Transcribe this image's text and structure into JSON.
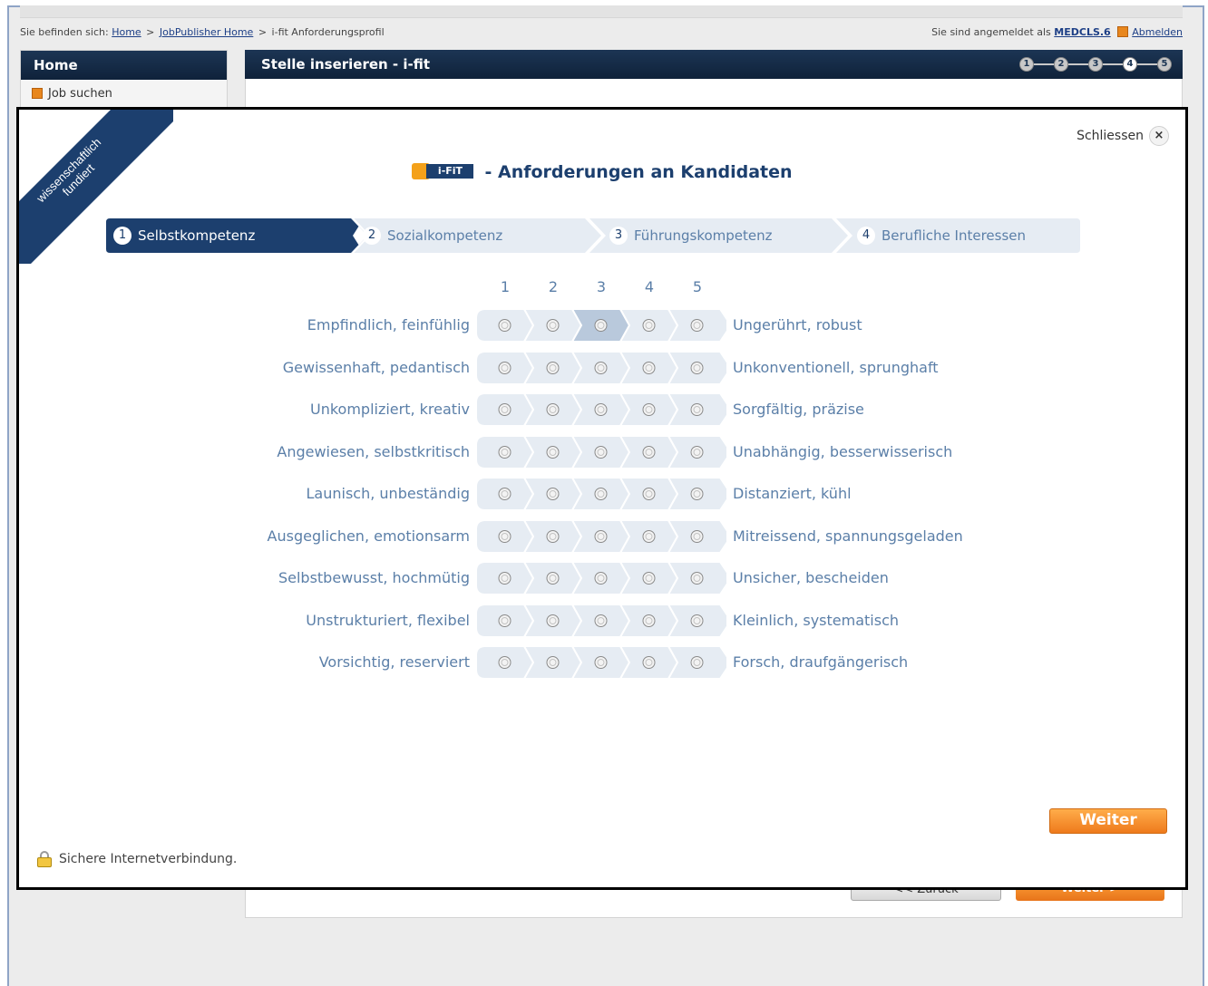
{
  "breadcrumb": {
    "prefix": "Sie befinden sich:",
    "items": [
      "Home",
      "JobPublisher Home",
      "i-fit Anforderungsprofil"
    ],
    "separator": ">"
  },
  "session": {
    "prefix": "Sie sind angemeldet als",
    "user": "MEDCLS.6",
    "logout": "Abmelden"
  },
  "sidebar": {
    "title": "Home",
    "items": [
      {
        "label": "Job suchen"
      }
    ]
  },
  "main": {
    "title": "Stelle inserieren - i-fit",
    "progress_steps": [
      "1",
      "2",
      "3",
      "4",
      "5"
    ],
    "progress_active": 4,
    "back_label": "<< Zurück",
    "next_label": "Weiter >"
  },
  "modal": {
    "ribbon": [
      "wissenschaftlich",
      "fundiert"
    ],
    "close_label": "Schliessen",
    "close_glyph": "×",
    "logo_text": "i-FiT",
    "title": "- Anforderungen an Kandidaten",
    "steps": [
      {
        "num": "1",
        "label": "Selbstkompetenz",
        "active": true
      },
      {
        "num": "2",
        "label": "Sozialkompetenz",
        "active": false
      },
      {
        "num": "3",
        "label": "Führungskompetenz",
        "active": false
      },
      {
        "num": "4",
        "label": "Berufliche Interessen",
        "active": false
      }
    ],
    "scale_labels": [
      "1",
      "2",
      "3",
      "4",
      "5"
    ],
    "rows": [
      {
        "left": "Empfindlich, feinfühlig",
        "right": "Ungerührt, robust",
        "selected": 3
      },
      {
        "left": "Gewissenhaft, pedantisch",
        "right": "Unkonventionell, sprunghaft",
        "selected": null
      },
      {
        "left": "Unkompliziert, kreativ",
        "right": "Sorgfältig, präzise",
        "selected": null
      },
      {
        "left": "Angewiesen, selbstkritisch",
        "right": "Unabhängig, besserwisserisch",
        "selected": null
      },
      {
        "left": "Launisch, unbeständig",
        "right": "Distanziert, kühl",
        "selected": null
      },
      {
        "left": "Ausgeglichen, emotionsarm",
        "right": "Mitreissend, spannungsgeladen",
        "selected": null
      },
      {
        "left": "Selbstbewusst, hochmütig",
        "right": "Unsicher, bescheiden",
        "selected": null
      },
      {
        "left": "Unstrukturiert, flexibel",
        "right": "Kleinlich, systematisch",
        "selected": null
      },
      {
        "left": "Vorsichtig, reserviert",
        "right": "Forsch, draufgängerisch",
        "selected": null
      }
    ],
    "next_label": "Weiter",
    "secure_label": "Sichere Internetverbindung."
  },
  "colors": {
    "navy": "#1c3f6e",
    "text_blue": "#5b7fa8",
    "orange": "#ee7a1c",
    "step_inactive": "#e6ecf3",
    "scale_bg": "#e6ecf3",
    "scale_selected": "#b9c9dc"
  }
}
